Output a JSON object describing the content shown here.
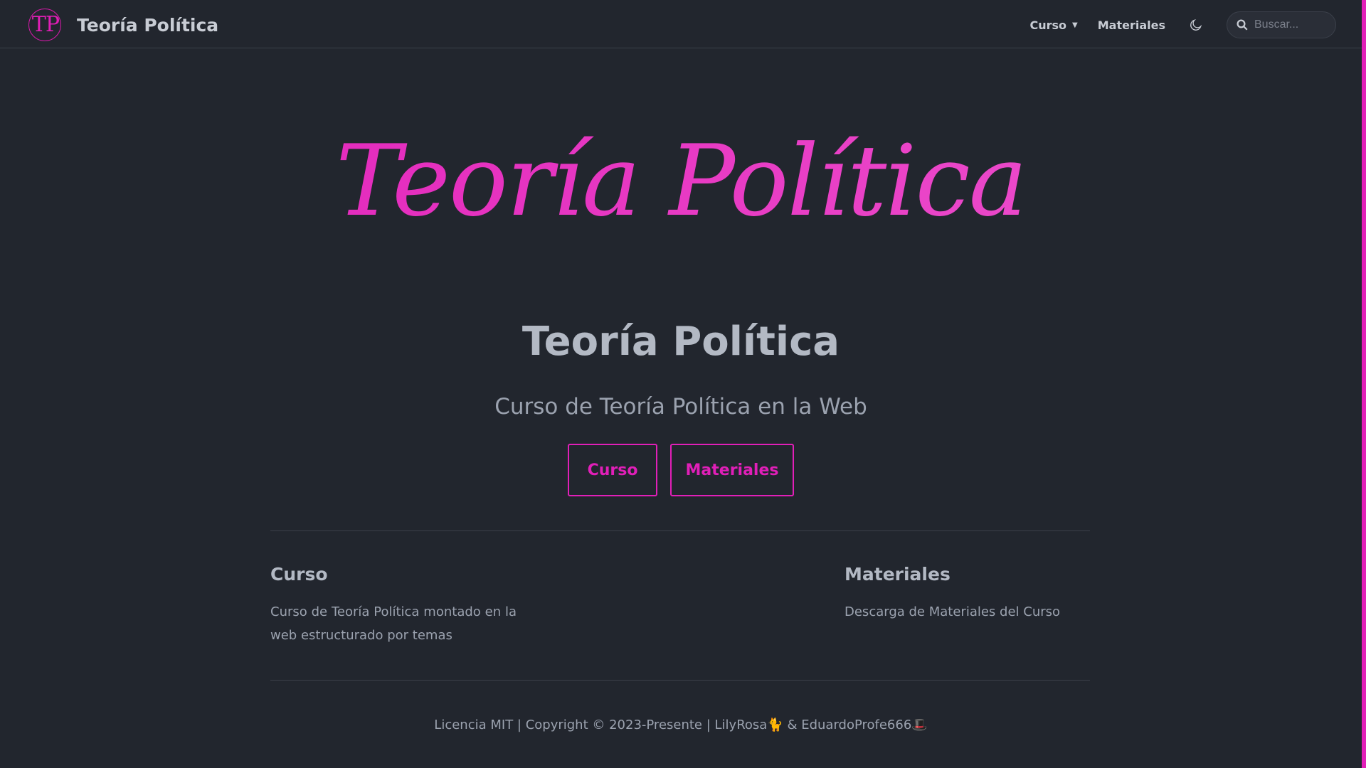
{
  "navbar": {
    "logo_text": "TP",
    "brand_title": "Teoría Política",
    "links": [
      {
        "label": "Curso",
        "has_dropdown": true
      },
      {
        "label": "Materiales",
        "has_dropdown": false
      }
    ],
    "theme_icon": "moon-icon",
    "search_placeholder": "Buscar..."
  },
  "hero": {
    "script_title": "Teoría Política",
    "title": "Teoría Política",
    "subtitle": "Curso de Teoría Política en la Web",
    "buttons": [
      {
        "label": "Curso"
      },
      {
        "label": "Materiales"
      }
    ]
  },
  "footer": {
    "columns": [
      {
        "title": "Curso",
        "text": "Curso de Teoría Política montado en la web estructurado por temas"
      },
      {
        "title": "Materiales",
        "text": "Descarga de Materiales del Curso"
      }
    ],
    "copyright": "Licencia MIT | Copyright © 2023-Presente | LilyRosa🐈 & EduardoProfe666🎩"
  },
  "colors": {
    "accent": "#e11fb8",
    "background": "#22262e",
    "text": "#c8ccd4",
    "muted_text": "#9ba2af"
  }
}
